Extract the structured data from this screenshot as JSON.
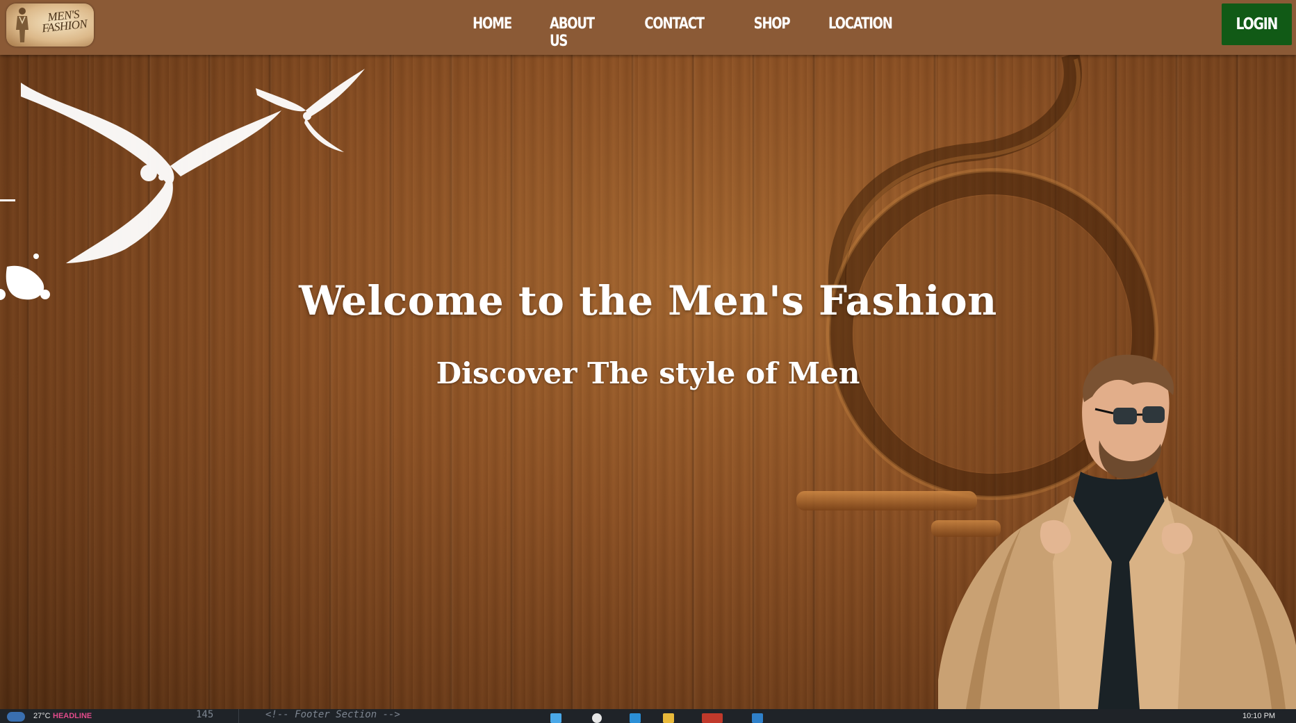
{
  "header": {
    "logo_text_line1": "MEN'S",
    "logo_text_line2": "FASHION"
  },
  "nav": {
    "items": [
      {
        "label": "HOME"
      },
      {
        "label": "ABOUT US"
      },
      {
        "label": "CONTACT"
      },
      {
        "label": "SHOP"
      },
      {
        "label": "LOCATION"
      }
    ],
    "login_label": "LOGIN"
  },
  "hero": {
    "title": "Welcome to the Men's Fashion",
    "subtitle": "Discover The style of Men"
  },
  "taskbar": {
    "temperature": "27°C",
    "news_label": "HEADLINE",
    "editor_line_number": "145",
    "editor_code_text": "<!-- Footer Section -->",
    "clock": "10:10 PM"
  },
  "colors": {
    "header_bg": "#8b5a36",
    "login_bg": "#115a16",
    "hero_wood": "#8a4f23",
    "text": "#ffffff"
  },
  "icons": [
    "logo-icon",
    "bird-icon",
    "model-photo-icon"
  ]
}
